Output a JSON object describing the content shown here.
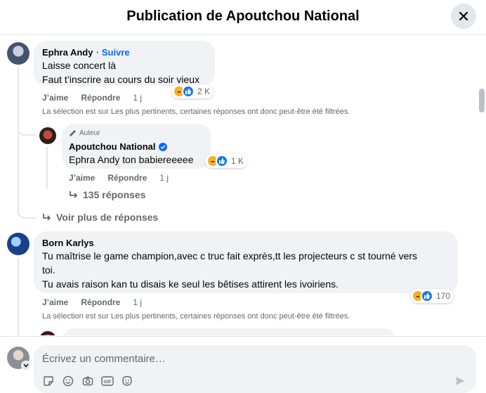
{
  "header": {
    "title": "Publication de Apoutchou National"
  },
  "comments": [
    {
      "author": "Ephra Andy",
      "follow": "Suivre",
      "lines": [
        "Laisse concert là",
        "Faut t’inscrire au cours du soir vieux"
      ],
      "like": "J’aime",
      "reply": "Répondre",
      "time": "1 j",
      "reaction_count": "2 K",
      "filter_note": "La sélection est sur Les plus pertinents, certaines réponses ont donc peut-être été filtrées.",
      "replies": [
        {
          "badge": "Auteur",
          "author": "Apoutchou National",
          "mention": "Ephra Andy",
          "text": " ton babiereeeee",
          "like": "J’aime",
          "reply": "Répondre",
          "time": "1 j",
          "reaction_count": "1 K",
          "replies_link": "135 réponses"
        }
      ],
      "more_replies": "Voir plus de réponses"
    },
    {
      "author": "Born Karlys",
      "lines": [
        "Tu maîtrise le game champion,avec c truc fait exprès,tt les projecteurs c st tourné vers",
        "toi.",
        "Tu avais raison kan tu disais ke seul les bêtises attirent les ivoiriens."
      ],
      "like": "J’aime",
      "reply": "Répondre",
      "time": "1 j",
      "reaction_count": "170",
      "filter_note": "La sélection est sur Les plus pertinents, certaines réponses ont donc peut-être été filtrées."
    }
  ],
  "composer": {
    "placeholder": "Écrivez un commentaire…"
  },
  "colors": {
    "accent": "#0866ff",
    "secondary_text": "#65676b",
    "bubble": "#f0f2f5",
    "haha": "#f7b125",
    "like": "#1877f2"
  }
}
